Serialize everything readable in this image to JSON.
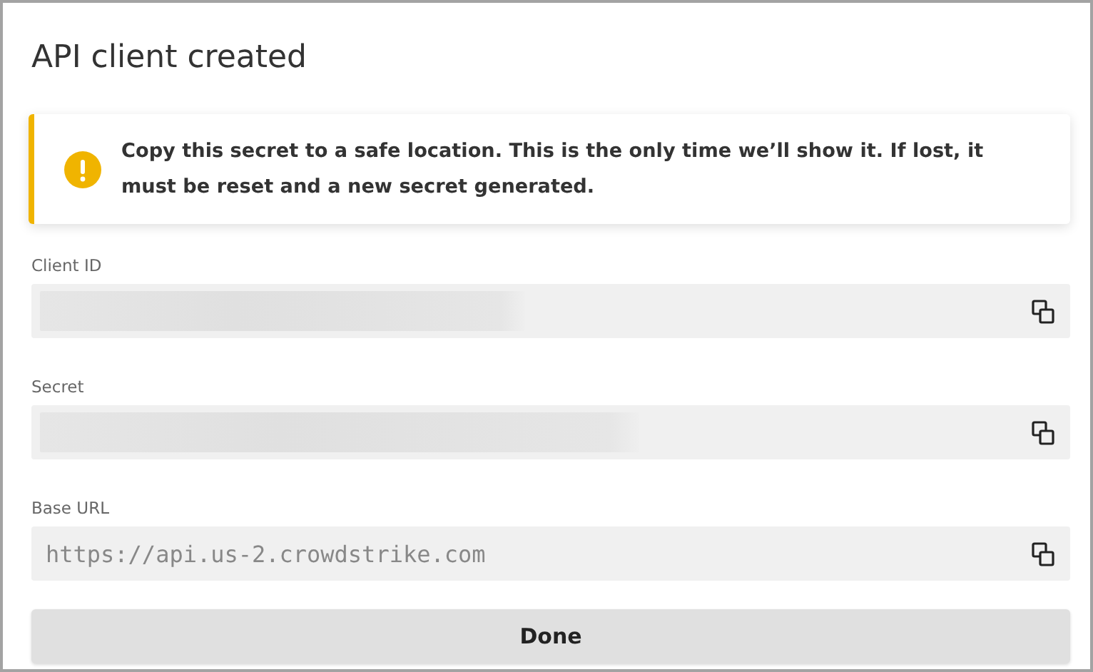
{
  "dialog": {
    "title": "API client created"
  },
  "alert": {
    "message": "Copy this secret to a safe location. This is the only time we’ll show it. If lost, it must be reset and a new secret generated."
  },
  "fields": [
    {
      "label": "Client ID",
      "kind": "redacted"
    },
    {
      "label": "Secret",
      "kind": "redacted"
    },
    {
      "label": "Base URL",
      "kind": "text",
      "value": "https://api.us-2.crowdstrike.com"
    }
  ],
  "buttons": [
    {
      "label": "Done"
    }
  ]
}
